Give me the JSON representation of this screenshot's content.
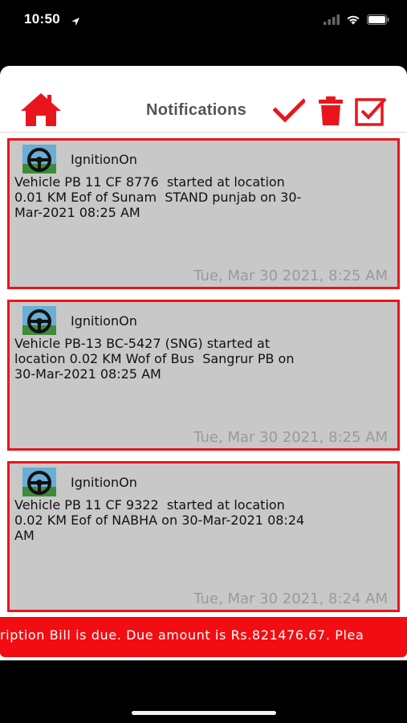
{
  "status": {
    "time": "10:50"
  },
  "header": {
    "title": "Notifications"
  },
  "notifications": [
    {
      "title": "IgnitionOn",
      "message": "Vehicle PB 11 CF 8776  started at location\n0.01 KM Eof of Sunam  STAND punjab on 30-\nMar-2021 08:25 AM",
      "timestamp": "Tue, Mar 30 2021, 8:25 AM"
    },
    {
      "title": "IgnitionOn",
      "message": "Vehicle PB-13 BC-5427 (SNG) started at\nlocation 0.02 KM Wof of Bus  Sangrur PB on\n30-Mar-2021 08:25 AM",
      "timestamp": "Tue, Mar 30 2021, 8:25 AM"
    },
    {
      "title": "IgnitionOn",
      "message": "Vehicle PB 11 CF 9322  started at location\n0.02 KM Eof of NABHA on 30-Mar-2021 08:24\nAM",
      "timestamp": "Tue, Mar 30 2021, 8:24 AM"
    }
  ],
  "ticker": {
    "text": "ription Bill is due. Due amount is Rs.821476.67. Plea"
  },
  "colors": {
    "accent": "#e8161c",
    "card_bg": "#c8c8c8",
    "ticker_bg": "#f20d12"
  }
}
